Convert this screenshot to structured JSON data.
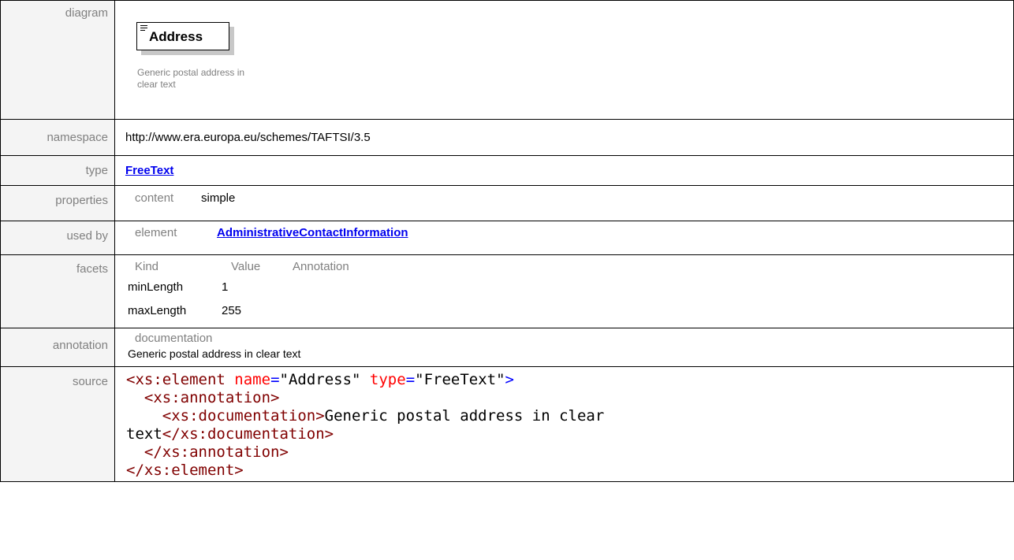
{
  "labels": {
    "diagram": "diagram",
    "namespace": "namespace",
    "type": "type",
    "properties": "properties",
    "used_by": "used by",
    "facets": "facets",
    "annotation": "annotation",
    "source": "source"
  },
  "diagram": {
    "node_title": "Address",
    "node_caption": "Generic postal address in clear text"
  },
  "namespace": "http://www.era.europa.eu/schemes/TAFTSI/3.5",
  "type": "FreeText",
  "properties": {
    "key": "content",
    "value": "simple"
  },
  "used_by": {
    "key": "element",
    "value": "AdministrativeContactInformation"
  },
  "facets": {
    "headers": [
      "Kind",
      "Value",
      "Annotation"
    ],
    "rows": [
      {
        "kind": "minLength",
        "value": "1"
      },
      {
        "kind": "maxLength",
        "value": "255"
      }
    ]
  },
  "annotation": {
    "key": "documentation",
    "text": "Generic postal address in clear text"
  },
  "source": {
    "l1_open": "<xs:element",
    "l1_attr1": "name",
    "l1_val1": "\"Address\"",
    "l1_attr2": "type",
    "l1_val2": "\"FreeText\"",
    "l1_close": ">",
    "l2": "<xs:annotation>",
    "l3_open": "<xs:documentation>",
    "l3_text": "Generic postal address in clear",
    "l4_text": "text",
    "l4_close": "</xs:documentation>",
    "l5": "</xs:annotation>",
    "l6": "</xs:element>"
  },
  "colors": {
    "link": "#0000ee",
    "label_text": "#808080",
    "xml_tag": "#800000",
    "xml_attr": "#ff0000",
    "xml_punct": "#0000ff"
  },
  "icons": {
    "node_icon": "element-doc-icon"
  }
}
